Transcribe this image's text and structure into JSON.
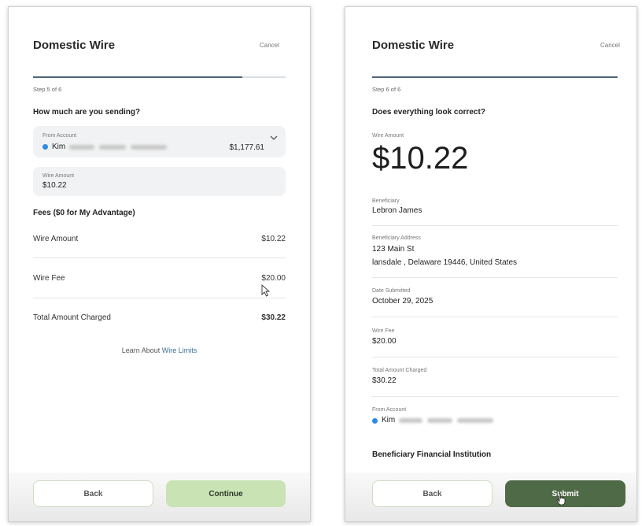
{
  "left": {
    "title": "Domestic Wire",
    "cancel": "Cancel",
    "step": "Step 5 of 6",
    "progress": 0.83,
    "question": "How much are you sending?",
    "from_account": {
      "label": "From Account",
      "name_visible": "Kim",
      "balance": "$1,177.61"
    },
    "wire_amount_field": {
      "label": "Wire Amount",
      "value": "$10.22"
    },
    "fees_heading": "Fees ($0 for My Advantage)",
    "rows": [
      {
        "label": "Wire Amount",
        "value": "$10.22"
      },
      {
        "label": "Wire Fee",
        "value": "$20.00"
      },
      {
        "label": "Total Amount Charged",
        "value": "$30.22"
      }
    ],
    "learn_prefix": "Learn About ",
    "learn_link": "Wire Limits",
    "back": "Back",
    "continue": "Continue"
  },
  "right": {
    "title": "Domestic Wire",
    "cancel": "Cancel",
    "step": "Step 6 of 6",
    "progress": 1.0,
    "question": "Does everything look correct?",
    "wire_amount_label": "Wire Amount",
    "wire_amount": "$10.22",
    "beneficiary_label": "Beneficiary",
    "beneficiary": "Lebron James",
    "address_label": "Beneficiary Address",
    "address_line1": "123 Main St",
    "address_line2": "lansdale , Delaware 19446, United States",
    "date_label": "Date Submitted",
    "date": "October 29, 2025",
    "fee_label": "Wire Fee",
    "fee": "$20.00",
    "total_label": "Total Amount Charged",
    "total": "$30.22",
    "from_label": "From Account",
    "from_name_visible": "Kim",
    "bank_heading": "Beneficiary Financial Institution",
    "back": "Back",
    "submit": "Submit"
  },
  "colors": {
    "progress": "#4f657a",
    "account_dot": "#2f8be0",
    "continue_bg": "#c9e3b4",
    "submit_bg": "#4f6a47",
    "link": "#3d6e93"
  }
}
